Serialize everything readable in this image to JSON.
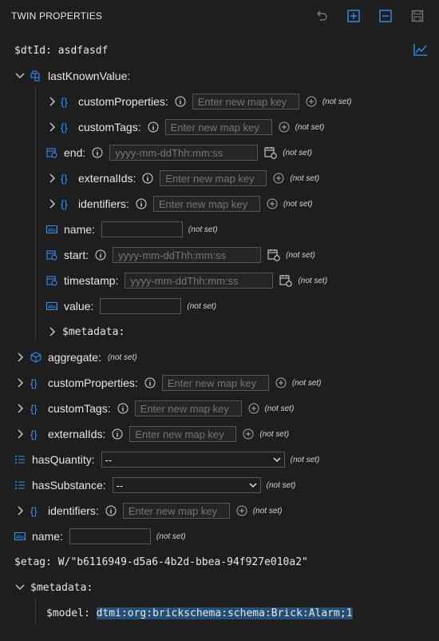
{
  "header": {
    "title": "TWIN PROPERTIES"
  },
  "dtid": {
    "label": "$dtId:",
    "value": "asdfasdf"
  },
  "lkv": {
    "label": "lastKnownValue:"
  },
  "placeholders": {
    "map_key": "Enter new map key",
    "datetime": "yyyy-mm-ddThh:mm:ss"
  },
  "not_set": "(not set)",
  "labels": {
    "customProperties": "customProperties:",
    "customTags": "customTags:",
    "end": "end:",
    "externalIds": "externalIds:",
    "identifiers": "identifiers:",
    "name": "name:",
    "start": "start:",
    "timestamp": "timestamp:",
    "value": "value:",
    "metadata": "$metadata:",
    "aggregate": "aggregate:",
    "hasQuantity": "hasQuantity:",
    "hasSubstance": "hasSubstance:"
  },
  "selects": {
    "hasQuantity": "--",
    "hasSubstance": "--"
  },
  "etag": {
    "label": "$etag:",
    "value": "W/\"b6116949-d5a6-4b2d-bbea-94f927e010a2\""
  },
  "metadata": {
    "label": "$metadata:",
    "model_label": "$model:",
    "model_value": "dtmi:org:brickschema:schema:Brick:Alarm;1"
  },
  "colors": {
    "accent": "#3794ff",
    "background": "#1e1e1e",
    "selection": "#264f78"
  }
}
